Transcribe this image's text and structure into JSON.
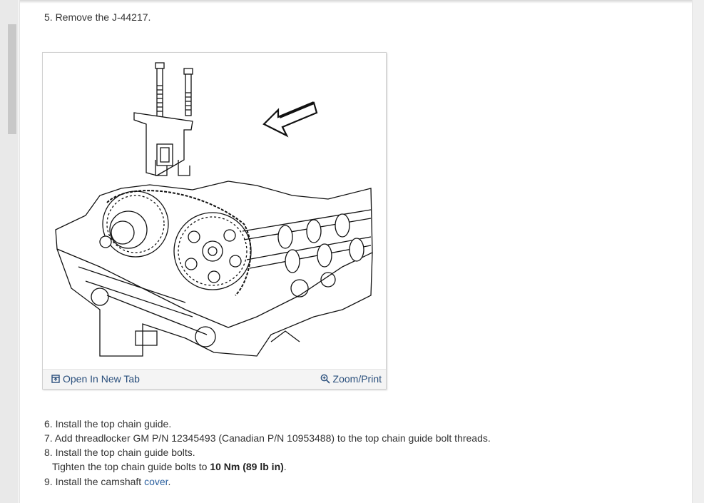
{
  "steps": {
    "step5": "5. Remove the J-44217.",
    "step6": "6. Install the top chain guide.",
    "step7": "7. Add threadlocker GM P/N 12345493 (Canadian P/N 10953488) to the top chain guide bolt threads.",
    "step8": "8. Install the top chain guide bolts.",
    "tighten_prefix": "Tighten the top chain guide bolts to ",
    "tighten_value": "10 Nm (89 lb in)",
    "tighten_suffix": ".",
    "step9_prefix": "9. Install the camshaft ",
    "step9_link": "cover",
    "step9_suffix": "."
  },
  "figure": {
    "open_new_tab_label": "Open In New Tab",
    "zoom_print_label": "Zoom/Print",
    "open_icon": "open-in-new-tab-icon",
    "zoom_icon": "zoom-in-icon"
  },
  "colors": {
    "link": "#2a5f9e",
    "toolbar_link": "#2a4f7c",
    "text": "#333333"
  }
}
